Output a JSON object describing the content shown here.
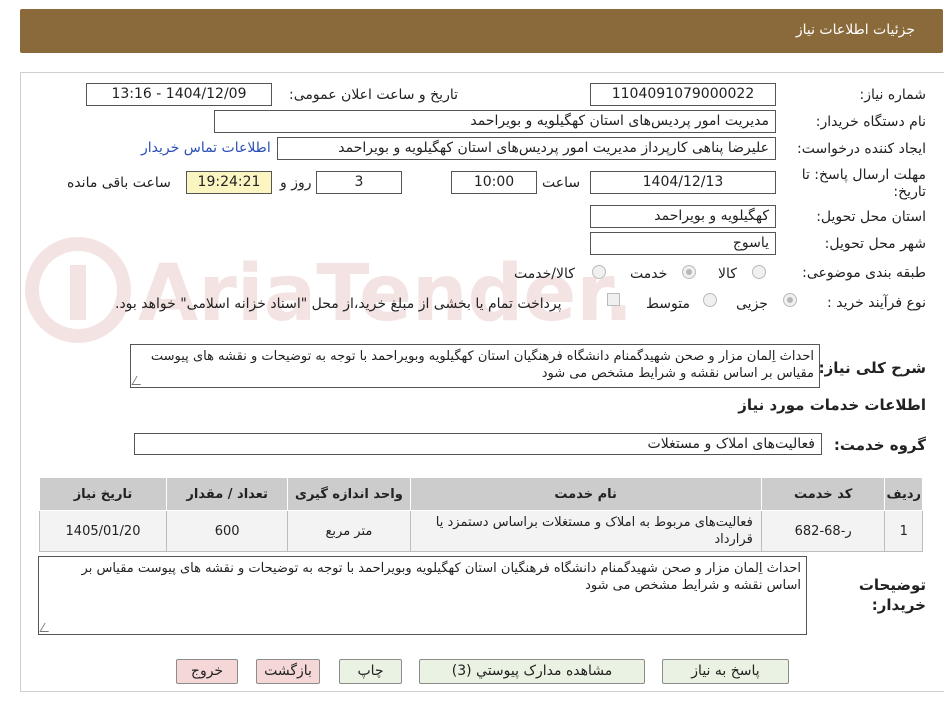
{
  "header": {
    "title": "جزئیات اطلاعات نیاز"
  },
  "watermark": "AriaTender.neT",
  "fields": {
    "need_number_label": "شماره نیاز:",
    "need_number": "1104091079000022",
    "announce_label": "تاریخ و ساعت اعلان عمومی:",
    "announce_value": "1404/12/09 - 13:16",
    "buyer_org_label": "نام دستگاه خریدار:",
    "buyer_org": "مدیریت امور پردیس‌های استان کهگیلویه و بویراحمد",
    "requester_label": "ایجاد کننده درخواست:",
    "requester": "علیرضا پناهی کارپرداز مدیریت امور پردیس‌های استان کهگیلویه و بویراحمد",
    "contact_link": "اطلاعات تماس خریدار",
    "deadline_label_1": "مهلت ارسال پاسخ: تا",
    "deadline_label_2": "تاریخ:",
    "deadline_date": "1404/12/13",
    "time_label": "ساعت",
    "deadline_time": "10:00",
    "days_value": "3",
    "days_label": "روز و",
    "remaining_time": "19:24:21",
    "remaining_label": "ساعت باقی مانده",
    "province_label": "استان محل تحویل:",
    "province": "کهگیلویه و بویراحمد",
    "city_label": "شهر محل تحویل:",
    "city": "یاسوج",
    "category_label": "طبقه بندی موضوعی:",
    "category_options": [
      "کالا",
      "خدمت",
      "کالا/خدمت"
    ],
    "category_selected": "خدمت",
    "process_label": "نوع فرآیند خرید :",
    "process_options": [
      "جزیی",
      "متوسط"
    ],
    "process_selected": "جزیی",
    "payment_note": "پرداخت تمام یا بخشی از مبلغ خرید،از محل \"اسناد خزانه اسلامی\" خواهد بود.",
    "summary_label": "شرح کلی نیاز:",
    "summary": "احداث اِلمان مزار و صحن شهیدگمنام دانشگاه فرهنگیان استان کهگیلویه وبویراحمد با توجه به توضیحات و نقشه های پیوست مقیاس بر اساس نقشه و شرایط مشخص می شود"
  },
  "services": {
    "section_title": "اطلاعات خدمات مورد نیاز",
    "group_label": "گروه خدمت:",
    "group_value": "فعالیت‌های  املاک و مستغلات",
    "columns": [
      "ردیف",
      "کد خدمت",
      "نام خدمت",
      "واحد اندازه گیری",
      "تعداد / مقدار",
      "تاریخ نیاز"
    ],
    "rows": [
      [
        "1",
        "ر-68-682",
        "فعالیت‌های مربوط به املاک و مستغلات براساس دستمزد یا قرارداد",
        "متر مربع",
        "600",
        "1405/01/20"
      ]
    ]
  },
  "buyer_notes": {
    "label_1": "توضیحات",
    "label_2": "خریدار:",
    "text": "احداث اِلمان مزار و صحن شهیدگمنام دانشگاه فرهنگیان استان کهگیلویه وبویراحمد با توجه به توضیحات و نقشه های پیوست مقیاس بر اساس نقشه و شرایط مشخص می شود"
  },
  "buttons": {
    "reply": "پاسخ به نیاز",
    "attachments": "مشاهده مدارک پیوستي (3)",
    "print": "چاپ",
    "back": "بازگشت",
    "exit": "خروج"
  }
}
